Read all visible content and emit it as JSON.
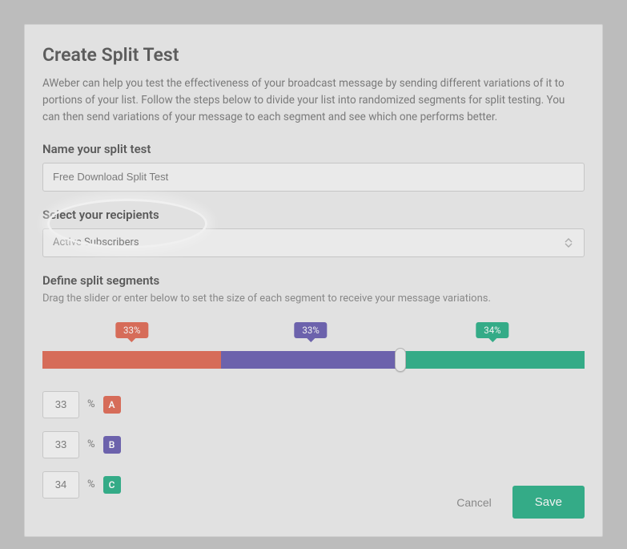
{
  "colors": {
    "segment_a": "#e06a55",
    "segment_b": "#6a5fb1",
    "segment_c": "#2cb088"
  },
  "header": {
    "title": "Create Split Test",
    "description": "AWeber can help you test the effectiveness of your broadcast message by sending different variations of it to portions of your list. Follow the steps below to divide your list into randomized segments for split testing. You can then send variations of your message to each segment and see which one performs better."
  },
  "name_section": {
    "label": "Name your split test",
    "value": "Free Download Split Test"
  },
  "recipients_section": {
    "label": "Select your recipients",
    "selected": "Active Subscribers"
  },
  "segments_section": {
    "label": "Define split segments",
    "helper": "Drag the slider or enter below to set the size of each segment to receive your message variations.",
    "percent_symbol": "%",
    "tooltips": {
      "a": "33%",
      "b": "33%",
      "c": "34%"
    },
    "values": {
      "a": "33",
      "b": "33",
      "c": "34"
    },
    "letters": {
      "a": "A",
      "b": "B",
      "c": "C"
    }
  },
  "footer": {
    "cancel": "Cancel",
    "save": "Save"
  }
}
